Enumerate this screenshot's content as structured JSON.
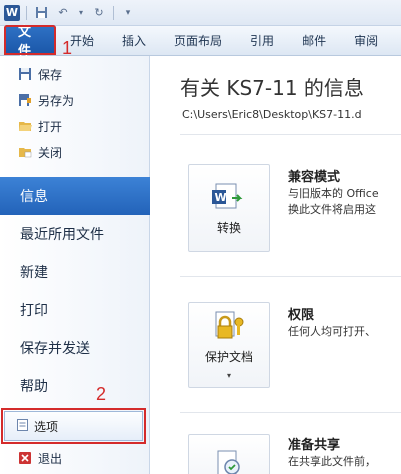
{
  "qat": {
    "app_icon": "word-logo-icon",
    "app_letter": "W"
  },
  "tabs": [
    {
      "label": "文件"
    },
    {
      "label": "开始"
    },
    {
      "label": "插入"
    },
    {
      "label": "页面布局"
    },
    {
      "label": "引用"
    },
    {
      "label": "邮件"
    },
    {
      "label": "审阅"
    }
  ],
  "markers": {
    "one": "1",
    "two": "2"
  },
  "nav": {
    "save": "保存",
    "save_as": "另存为",
    "open": "打开",
    "close": "关闭",
    "info": "信息",
    "recent": "最近所用文件",
    "new": "新建",
    "print": "打印",
    "save_send": "保存并发送",
    "help": "帮助",
    "options": "选项",
    "exit": "退出"
  },
  "main": {
    "title": "有关 KS7-11 的信息",
    "path": "C:\\Users\\Eric8\\Desktop\\KS7-11.d",
    "sections": [
      {
        "button": "转换",
        "title": "兼容模式",
        "desc1": "与旧版本的 Office",
        "desc2": "换此文件将启用这"
      },
      {
        "button": "保护文档",
        "title": "权限",
        "desc1": "任何人均可打开、"
      },
      {
        "title": "准备共享",
        "desc1": "在共享此文件前，"
      }
    ]
  },
  "colors": {
    "accent": "#2b6cc4",
    "highlight_box": "#d42b2b"
  }
}
